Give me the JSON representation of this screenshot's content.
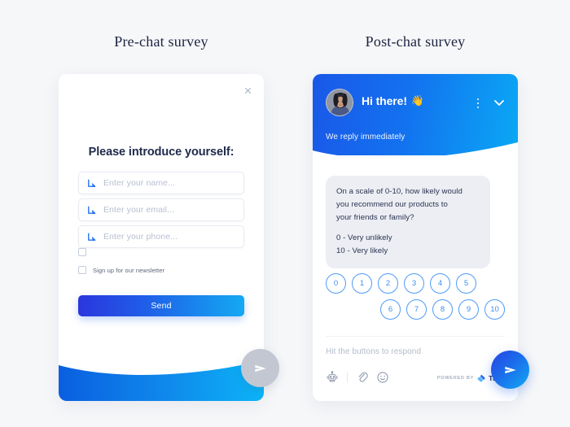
{
  "page": {
    "background_color": "#f6f7f9"
  },
  "sections": {
    "pre_title": "Pre-chat survey",
    "post_title": "Post-chat survey"
  },
  "pre_chat": {
    "close_icon": "close-icon",
    "heading": "Please introduce yourself:",
    "fields": [
      {
        "icon": "arrow-down-right-icon",
        "placeholder": "Enter your name..."
      },
      {
        "icon": "arrow-down-right-icon",
        "placeholder": "Enter your email..."
      },
      {
        "icon": "arrow-down-right-icon",
        "placeholder": "Enter your phone..."
      }
    ],
    "checkboxes": [
      {
        "label": "",
        "checked": false
      },
      {
        "label": "Sign up for our newsletter",
        "checked": false
      }
    ],
    "send_label": "Send",
    "send_gradient": [
      "#2b36dd",
      "#14a9f2"
    ],
    "wave_gradient": [
      "#0a5fe0",
      "#0cb4f7"
    ],
    "fab": {
      "icon": "send-plane-icon",
      "color": "#c2c7d2"
    }
  },
  "post_chat": {
    "header": {
      "avatar": "agent-avatar",
      "greeting": "Hi there!",
      "greeting_emoji": "👋",
      "menu_icon": "more-options-icon",
      "collapse_icon": "chevron-down-icon",
      "status": "We reply immediately",
      "gradient": [
        "#1a58e8",
        "#0aa8f5"
      ]
    },
    "message": {
      "line1": "On a scale of 0-10, how likely would",
      "line2": "you recommend our products to",
      "line3": "your friends or family?",
      "line4": "0 - Very unlikely",
      "line5": "10 - Very likely",
      "bubble_color": "#eceef3"
    },
    "rating": {
      "row1": [
        "0",
        "1",
        "2",
        "3",
        "4",
        "5"
      ],
      "row2": [
        "6",
        "7",
        "8",
        "9",
        "10"
      ],
      "accent_color": "#4f9bf7"
    },
    "composer": {
      "placeholder": "Hit the buttons to respond",
      "tools": [
        "bot-icon",
        "attachment-icon",
        "emoji-icon"
      ]
    },
    "branding": {
      "powered_by": "POWERED BY",
      "brand": "TIDIO",
      "mark_icon": "tidio-logo-icon"
    },
    "fab": {
      "icon": "send-plane-icon",
      "gradient": [
        "#2b43e2",
        "#12aaf4"
      ]
    }
  }
}
